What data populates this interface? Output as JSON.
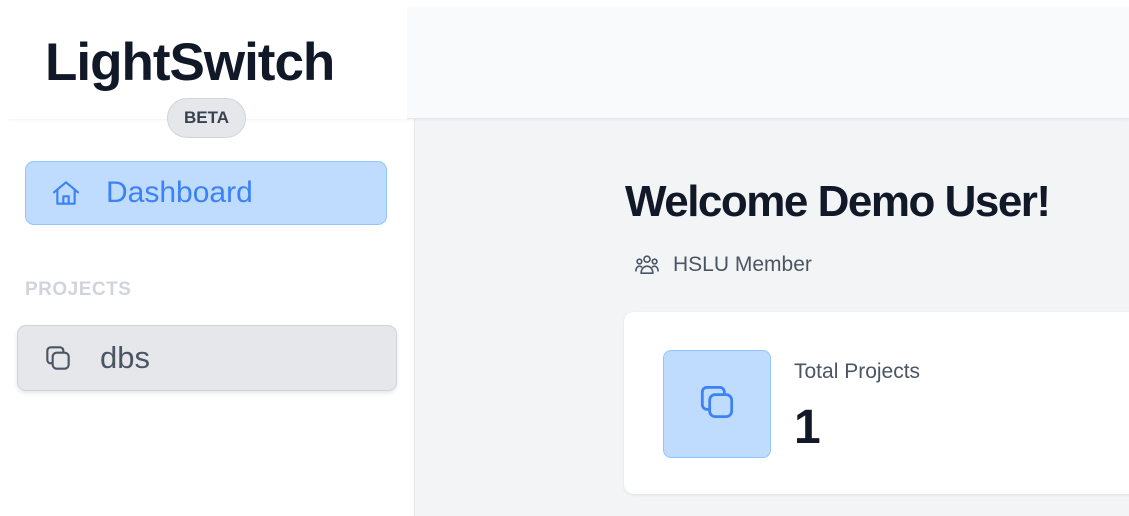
{
  "app": {
    "name": "LightSwitch",
    "badge": "BETA"
  },
  "sidebar": {
    "nav": [
      {
        "label": "Dashboard",
        "icon": "home-icon",
        "active": true
      }
    ],
    "projects_heading": "PROJECTS",
    "projects": [
      {
        "label": "dbs",
        "icon": "copy-icon"
      }
    ]
  },
  "main": {
    "welcome": "Welcome Demo User!",
    "role": {
      "label": "HSLU Member",
      "icon": "users-icon"
    },
    "stats": [
      {
        "title": "Total Projects",
        "value": "1",
        "icon": "copy-icon"
      }
    ]
  },
  "colors": {
    "accent": "#3b82f6",
    "accent_bg": "#bfdbfe",
    "accent_border": "#93c5fd",
    "text_dark": "#111827",
    "text_muted": "#4b5563"
  }
}
